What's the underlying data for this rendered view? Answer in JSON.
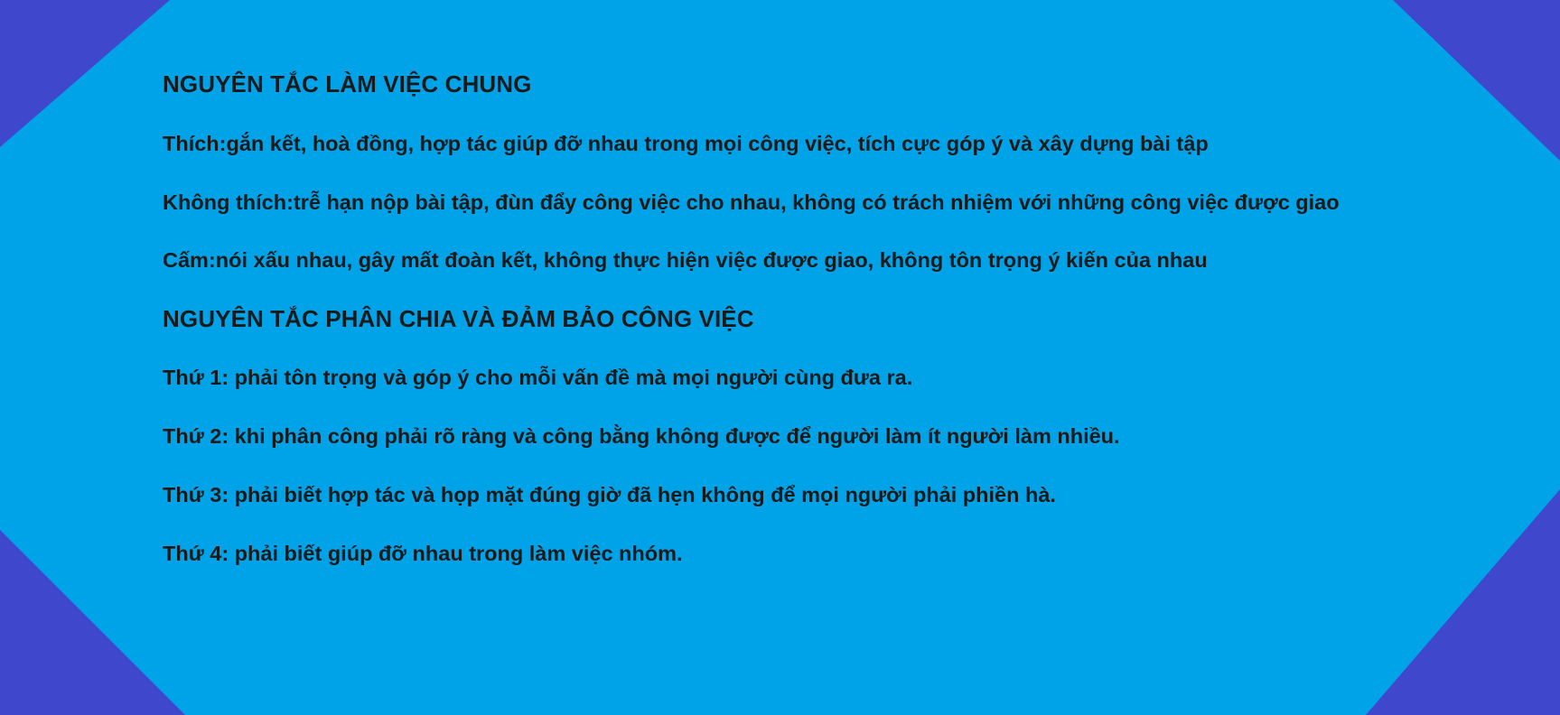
{
  "colors": {
    "background": "#00a3e8",
    "corner": "#3f48cc",
    "text": "#1a1a1a"
  },
  "section1": {
    "title": "NGUYÊN TẮC LÀM VIỆC CHUNG",
    "like": "Thích:gắn kết, hoà đồng, hợp tác giúp đỡ nhau trong mọi công việc, tích cực góp ý và xây dựng bài tập",
    "dislike": "Không thích:trễ hạn nộp bài tập, đùn đẩy công việc cho nhau, không có trách nhiệm với những công việc được giao",
    "forbidden": "Cấm:nói xấu nhau, gây mất đoàn kết, không thực hiện việc được giao, không tôn trọng ý kiến của nhau"
  },
  "section2": {
    "title": "NGUYÊN TẮC PHÂN CHIA VÀ ĐẢM BẢO CÔNG VIỆC",
    "rules": [
      "Thứ 1: phải tôn trọng và góp ý cho mỗi vấn đề mà mọi người cùng đưa ra.",
      "Thứ 2: khi phân công phải rõ ràng và công bằng không được để người làm ít người làm nhiều.",
      "Thứ 3: phải biết hợp tác và họp mặt đúng giờ đã hẹn không để mọi người phải phiền hà.",
      "Thứ 4: phải biết giúp đỡ nhau trong làm việc nhóm."
    ]
  }
}
